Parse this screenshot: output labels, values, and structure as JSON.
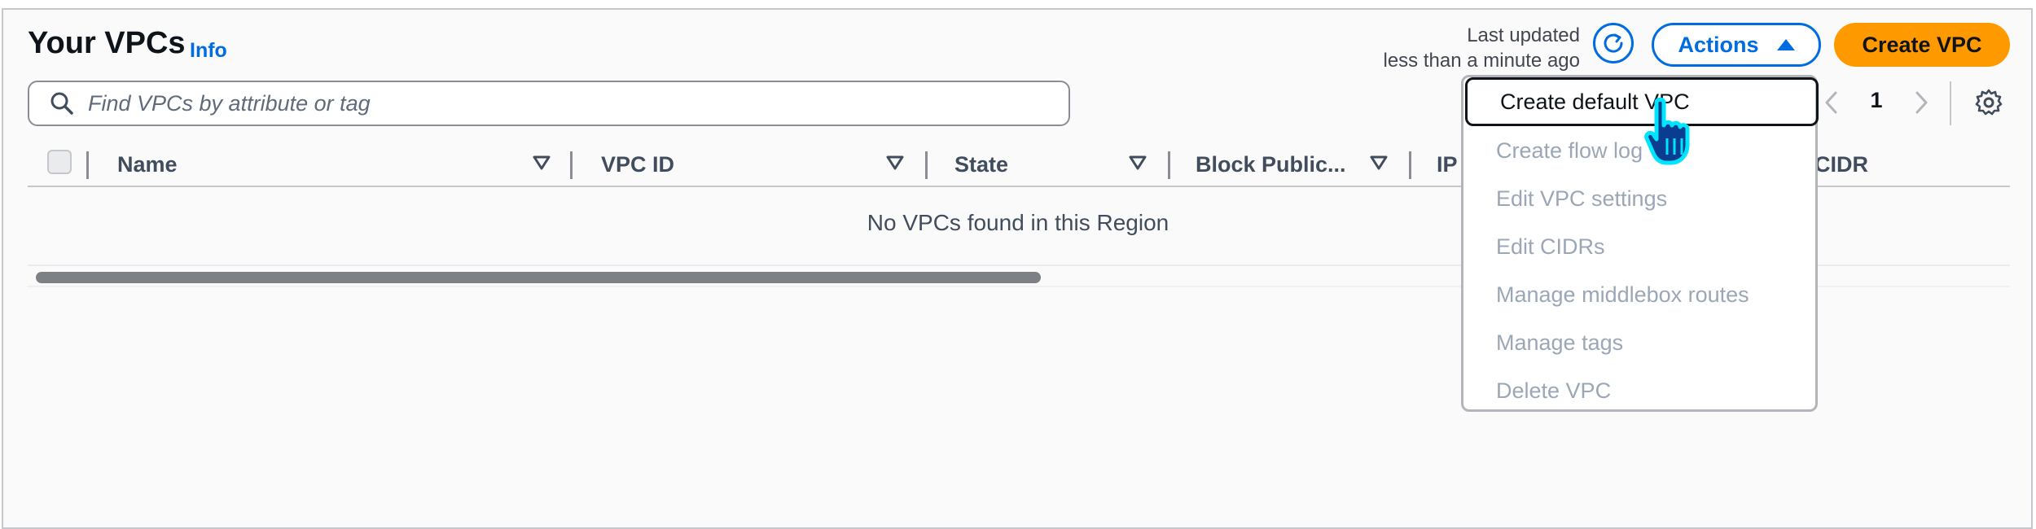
{
  "header": {
    "title": "Your VPCs",
    "info_link": "Info",
    "last_updated_line1": "Last updated",
    "last_updated_line2": "less than a minute ago",
    "actions_label": "Actions",
    "create_label": "Create VPC"
  },
  "search": {
    "placeholder": "Find VPCs by attribute or tag"
  },
  "pagination": {
    "current_page": "1"
  },
  "table": {
    "columns": [
      "Name",
      "VPC ID",
      "State",
      "Block Public...",
      "IP",
      "CIDR"
    ],
    "empty_message": "No VPCs found in this Region"
  },
  "actions_menu": {
    "items": [
      {
        "label": "Create default VPC",
        "enabled": true
      },
      {
        "label": "Create flow log",
        "enabled": false
      },
      {
        "label": "Edit VPC settings",
        "enabled": false
      },
      {
        "label": "Edit CIDRs",
        "enabled": false
      },
      {
        "label": "Manage middlebox routes",
        "enabled": false
      },
      {
        "label": "Manage tags",
        "enabled": false
      },
      {
        "label": "Delete VPC",
        "enabled": false
      }
    ]
  },
  "colors": {
    "accent_blue": "#006ce0",
    "primary_orange": "#ff9900",
    "disabled_text": "#9ba7b6"
  },
  "icons": [
    "refresh-icon",
    "caret-up-icon",
    "search-icon",
    "chevron-left-icon",
    "chevron-right-icon",
    "gear-icon",
    "sort-down-icon",
    "hand-pointer-icon"
  ]
}
